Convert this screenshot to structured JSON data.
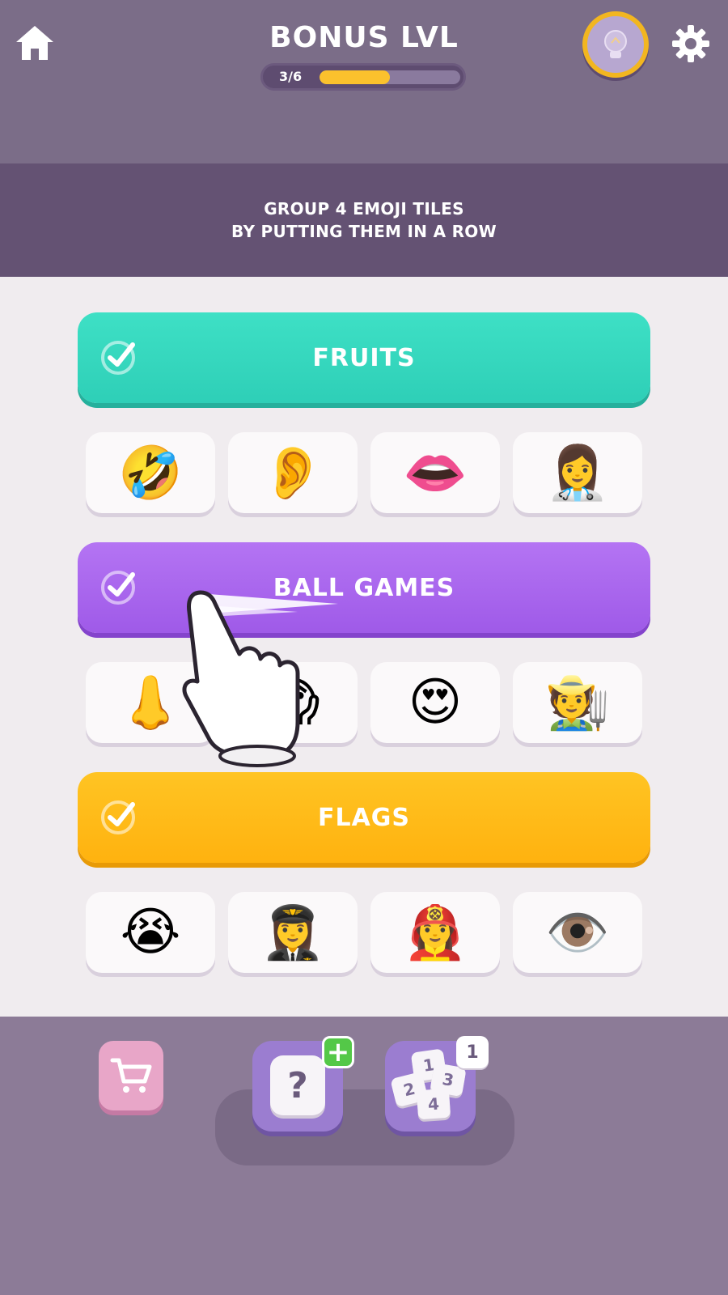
{
  "header": {
    "title": "BONUS LVL",
    "progress": {
      "label": "3/6",
      "fraction": 0.5
    },
    "icons": {
      "home": "home-icon",
      "hint": "lightbulb-icon",
      "settings": "gear-icon"
    }
  },
  "instruction": {
    "line1": "GROUP 4 EMOJI TILES",
    "line2": "BY PUTTING THEM IN A ROW"
  },
  "categories": [
    {
      "label": "FRUITS",
      "color": "#3ddcc3",
      "solved": true
    },
    {
      "label": "BALL GAMES",
      "color": "#aa65ef",
      "solved": true
    },
    {
      "label": "FLAGS",
      "color": "#ffbb1a",
      "solved": true
    }
  ],
  "tiles": [
    [
      "🤣",
      "👂",
      "👄",
      "👩‍⚕️"
    ],
    [
      "👃",
      "😱",
      "😍",
      "🧑‍🌾"
    ],
    [
      "😭",
      "👩‍✈️",
      "👩‍🚒",
      "👁️"
    ]
  ],
  "bottom": {
    "shop_icon": "cart-icon",
    "question_booster": {
      "label": "?",
      "badge": "+"
    },
    "numbers_booster": {
      "badge": "1",
      "cards": [
        "1",
        "2",
        "3",
        "4"
      ]
    }
  }
}
